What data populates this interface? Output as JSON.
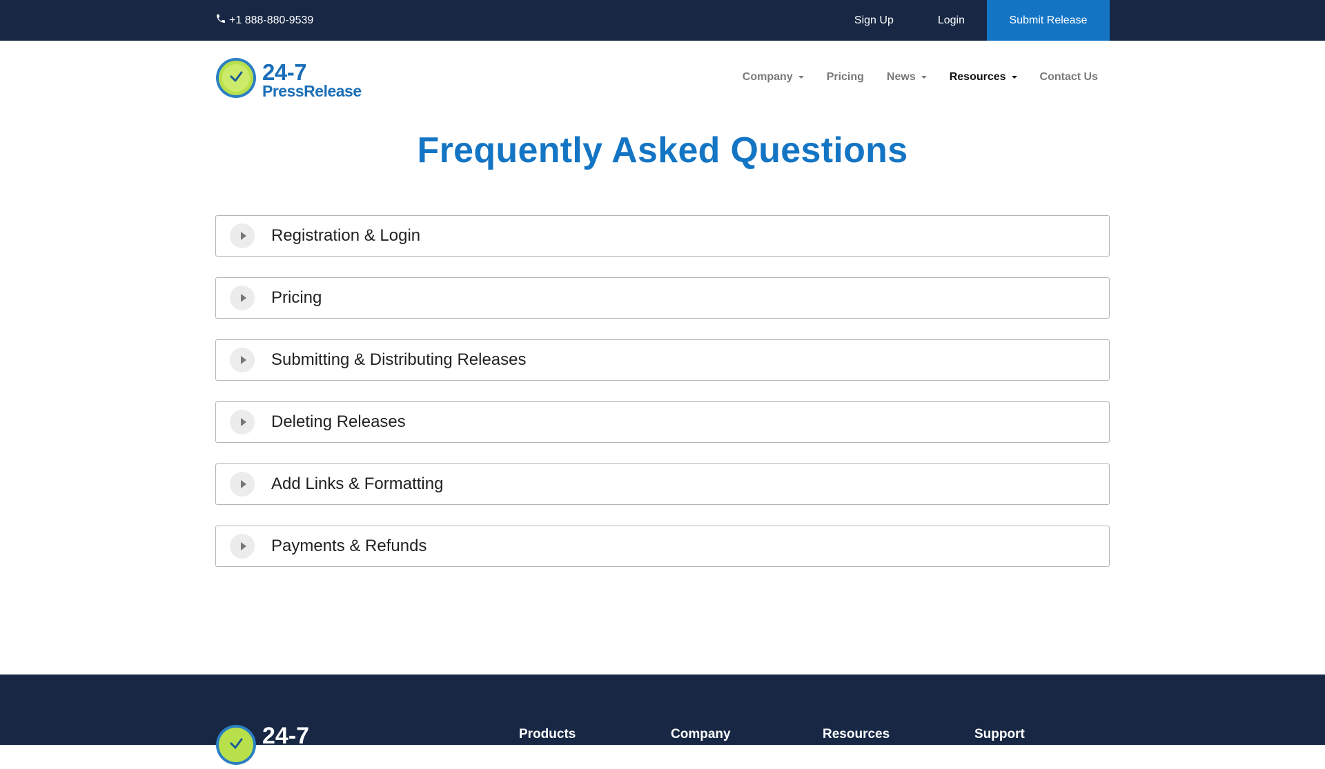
{
  "topbar": {
    "phone": "+1 888-880-9539",
    "signup_label": "Sign Up",
    "login_label": "Login",
    "submit_label": "Submit Release"
  },
  "header": {
    "logo_line1": "24-7",
    "logo_line2": "PressRelease",
    "nav": [
      {
        "label": "Company",
        "dropdown": true
      },
      {
        "label": "Pricing",
        "dropdown": false
      },
      {
        "label": "News",
        "dropdown": true
      },
      {
        "label": "Resources",
        "dropdown": true,
        "active": true
      },
      {
        "label": "Contact Us",
        "dropdown": false
      }
    ]
  },
  "main": {
    "title": "Frequently Asked Questions",
    "faq": [
      {
        "label": "Registration & Login"
      },
      {
        "label": "Pricing"
      },
      {
        "label": "Submitting & Distributing Releases"
      },
      {
        "label": "Deleting Releases"
      },
      {
        "label": "Add Links & Formatting"
      },
      {
        "label": "Payments & Refunds"
      }
    ]
  },
  "footer": {
    "logo_text": "24-7",
    "columns": [
      {
        "label": "Products"
      },
      {
        "label": "Company"
      },
      {
        "label": "Resources"
      },
      {
        "label": "Support"
      }
    ]
  },
  "colors": {
    "navy": "#172744",
    "accent": "#1475c4",
    "logo_green": "#b8e04a"
  },
  "icons": {
    "phone": "phone-icon",
    "logo": "clock-logo-icon",
    "faq_toggle": "play-triangle-icon",
    "dropdown": "caret-down-icon"
  }
}
